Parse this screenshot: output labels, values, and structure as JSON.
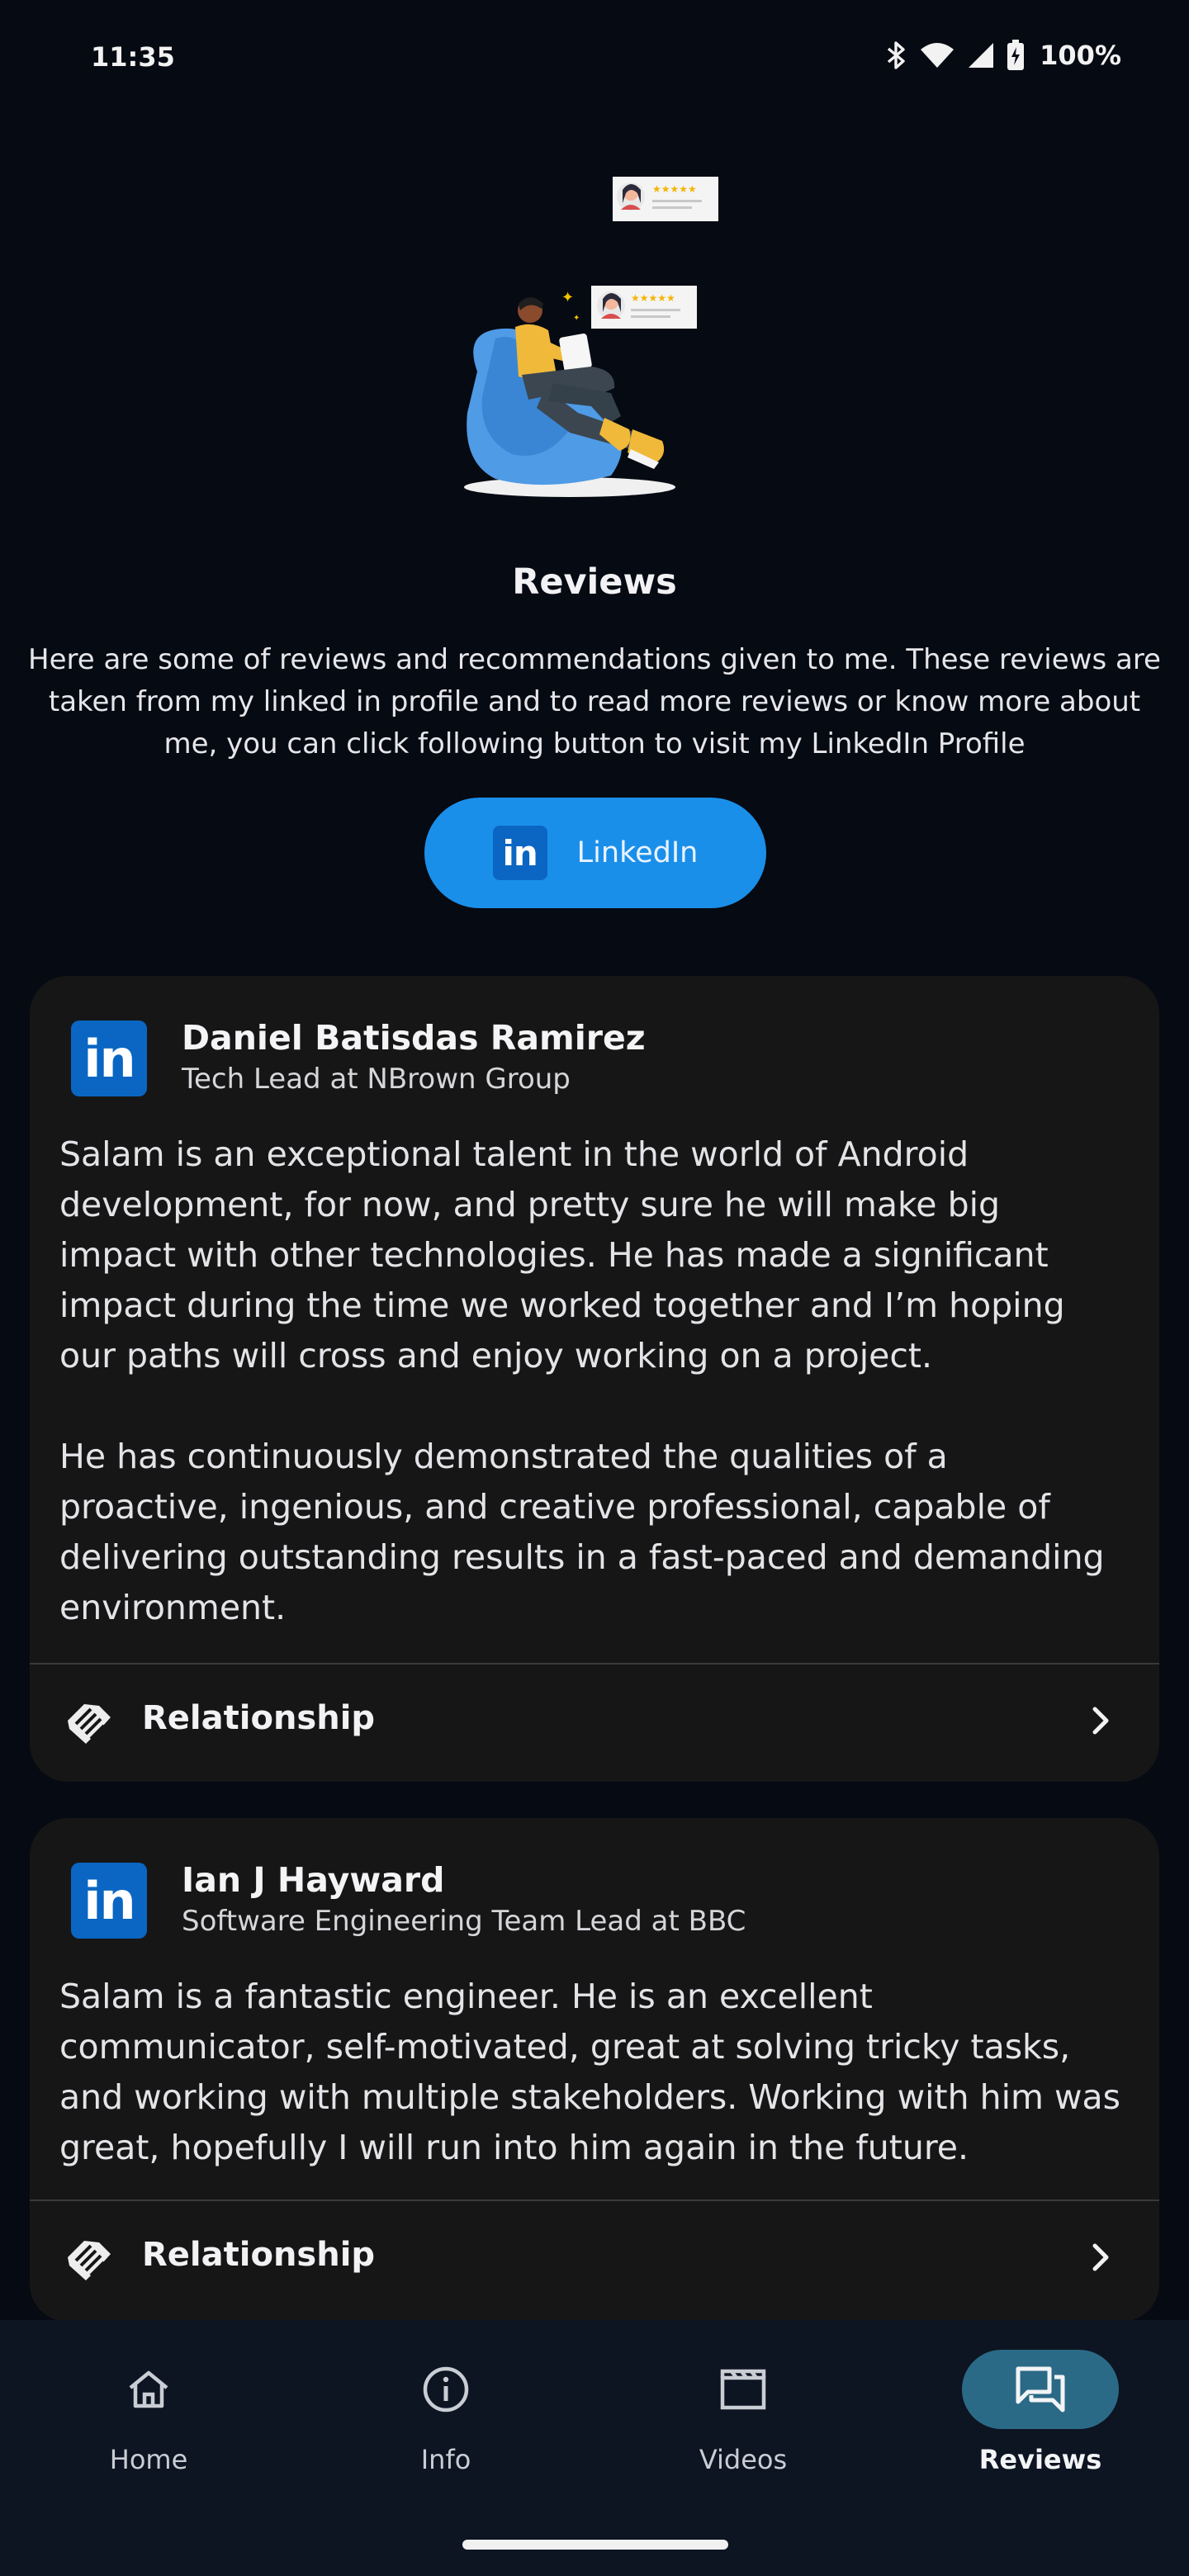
{
  "status_bar": {
    "time": "11:35",
    "battery": "100%",
    "icons": [
      "bluetooth-icon",
      "wifi-icon",
      "cell-signal-icon",
      "battery-charging-icon"
    ]
  },
  "page": {
    "title": "Reviews",
    "intro": "Here are some of reviews and recommendations given to me. These reviews are taken from my linked in profile and to read more reviews or know more about me, you can click following button to visit my LinkedIn Profile",
    "linkedin_button": {
      "label": "LinkedIn",
      "icon": "linkedin-icon"
    }
  },
  "reviews": [
    {
      "name": "Daniel Batisdas Ramirez",
      "role": "Tech Lead at NBrown Group",
      "text": "Salam is an exceptional talent in the world of Android development, for now, and pretty sure he will make big impact with other technologies. He has made a significant impact during the time we worked together and I’m hoping our paths will cross and enjoy working on a project.\n\n He has continuously demonstrated the qualities of a proactive, ingenious, and creative professional, capable of delivering outstanding results in a fast-paced and demanding environment.",
      "relationship_label": "Relationship"
    },
    {
      "name": "Ian J Hayward",
      "role": "Software Engineering Team Lead at BBC",
      "text": "Salam is a fantastic engineer. He is an excellent communicator, self-motivated, great at solving tricky tasks, and working with multiple stakeholders. Working with him was great, hopefully I will run into him again in the future.",
      "relationship_label": "Relationship"
    }
  ],
  "bottom_nav": {
    "items": [
      {
        "label": "Home",
        "icon": "home-icon",
        "active": false
      },
      {
        "label": "Info",
        "icon": "info-icon",
        "active": false
      },
      {
        "label": "Videos",
        "icon": "clapperboard-icon",
        "active": false
      },
      {
        "label": "Reviews",
        "icon": "reviews-chat-icon",
        "active": true
      }
    ]
  },
  "colors": {
    "background": "#060a12",
    "card": "#161616",
    "linkedin_button": "#1a8fea",
    "linkedin_brand": "#0a66c2",
    "nav_background": "#0d1422",
    "nav_active_pill": "#2b6a86"
  }
}
